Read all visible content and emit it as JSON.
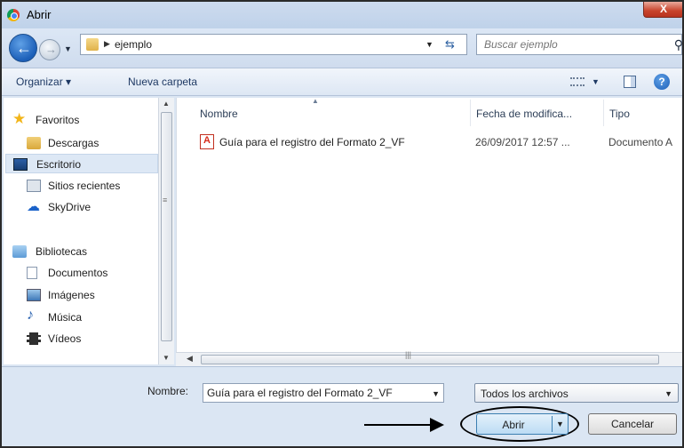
{
  "window": {
    "title": "Abrir",
    "close_glyph": "X"
  },
  "nav": {
    "breadcrumb": "ejemplo",
    "search_placeholder": "Buscar ejemplo"
  },
  "toolbar": {
    "organize_label": "Organizar ▾",
    "new_folder_label": "Nueva carpeta"
  },
  "sidebar": {
    "items": [
      {
        "label": "Favoritos",
        "icon": "star-icon"
      },
      {
        "label": "Descargas",
        "icon": "downloads-folder-icon"
      },
      {
        "label": "Escritorio",
        "icon": "desktop-icon",
        "selected": true
      },
      {
        "label": "Sitios recientes",
        "icon": "recent-places-icon"
      },
      {
        "label": "SkyDrive",
        "icon": "skydrive-cloud-icon"
      },
      {
        "label": "Bibliotecas",
        "icon": "libraries-icon"
      },
      {
        "label": "Documentos",
        "icon": "documents-icon"
      },
      {
        "label": "Imágenes",
        "icon": "pictures-icon"
      },
      {
        "label": "Música",
        "icon": "music-note-icon"
      },
      {
        "label": "Vídeos",
        "icon": "videos-icon"
      }
    ]
  },
  "filelist": {
    "columns": [
      "Nombre",
      "Fecha de modifica...",
      "Tipo"
    ],
    "rows": [
      {
        "name": "Guía para el registro del Formato 2_VF",
        "date": "26/09/2017 12:57 ...",
        "type": "Documento A",
        "icon": "pdf-file-icon"
      }
    ]
  },
  "footer": {
    "filename_label": "Nombre:",
    "filename_value": "Guía para el registro del Formato 2_VF",
    "filter_value": "Todos los archivos",
    "open_label": "Abrir",
    "cancel_label": "Cancelar"
  },
  "colors": {
    "chrome": "#dbe6f3",
    "accent": "#1c5fb8",
    "close": "#c8432b"
  }
}
